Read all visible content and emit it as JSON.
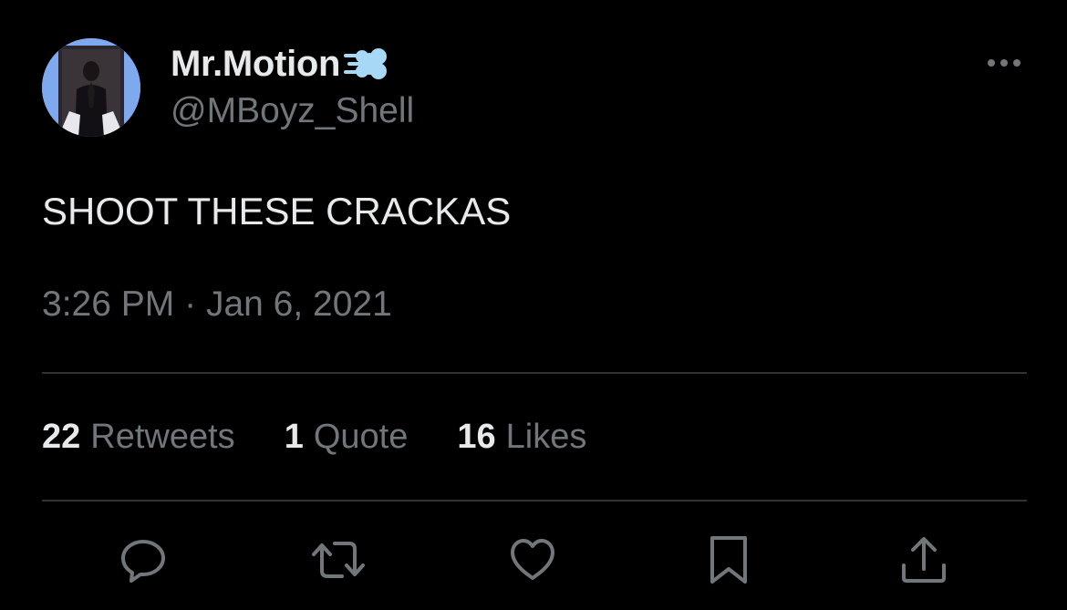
{
  "tweet": {
    "display_name": "Mr.Motion",
    "name_emoji": "dash-emoji",
    "handle": "@MBoyz_Shell",
    "text": "SHOOT THESE CRACKAS",
    "time": "3:26 PM",
    "separator": "·",
    "date": "Jan 6, 2021"
  },
  "stats": {
    "retweets": {
      "count": "22",
      "label": "Retweets"
    },
    "quotes": {
      "count": "1",
      "label": "Quote"
    },
    "likes": {
      "count": "16",
      "label": "Likes"
    }
  },
  "actions": [
    {
      "icon": "reply-icon"
    },
    {
      "icon": "retweet-icon"
    },
    {
      "icon": "like-icon"
    },
    {
      "icon": "bookmark-icon"
    },
    {
      "icon": "share-icon"
    }
  ],
  "colors": {
    "background": "#000000",
    "primary_text": "#e7e9ea",
    "secondary_text": "#71767b",
    "divider": "#2f3336",
    "icon": "#71767b",
    "avatar_bg": "#7fa9ee",
    "emoji": "#a7d8f5"
  }
}
